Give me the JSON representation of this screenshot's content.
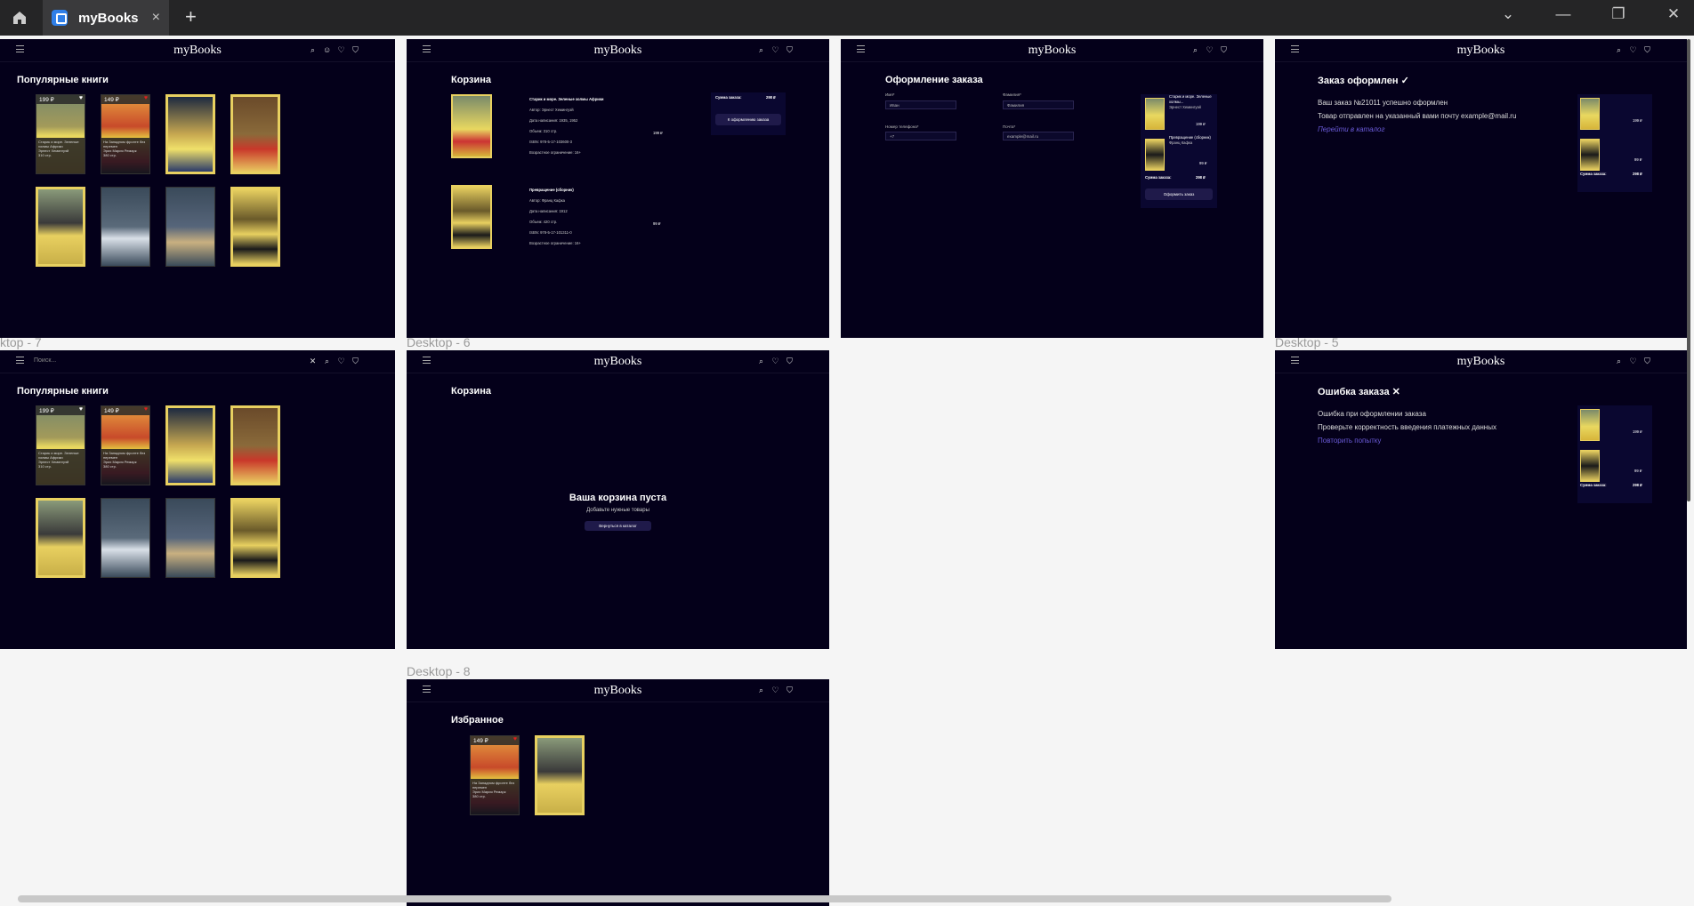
{
  "window": {
    "tab_title": "myBooks",
    "home": "home-icon",
    "new_tab": "+",
    "close_tab": "×",
    "ctrl_minimize": "—",
    "ctrl_restore": "❐",
    "ctrl_close": "✕",
    "ctrl_menu": "⌄"
  },
  "labels": {
    "d7": "ktop - 7",
    "d6": "Desktop - 6",
    "d5": "Desktop - 5",
    "d8": "Desktop - 8"
  },
  "logo": "myBooks",
  "popular": {
    "title": "Популярные книги"
  },
  "books": [
    {
      "price": "199 ₽",
      "author": "ЭРНЕСТ",
      "title": "Старик и море. Зеленые холмы Африки",
      "sub": "Эрнест Хемингуэй",
      "pages": "310 стр."
    },
    {
      "price": "149 ₽",
      "author": "РЕМАРК",
      "title": "На Западном фронте без перемен",
      "sub": "Эрих Мария Ремарк",
      "pages": "380 стр."
    },
    {
      "price": "",
      "author": "ФИЦДЖЕРАЛЬД"
    },
    {
      "price": "",
      "author": "ХАРПЕР ЛИ"
    },
    {
      "price": "",
      "author": "ДОСТОЕВСКИЙ"
    },
    {
      "price": "",
      "author": "КИЗ"
    },
    {
      "price": "",
      "author": "НАД ПРОПАСТЬЮ ВО РЖИ"
    },
    {
      "price": "",
      "author": "КАФКА"
    }
  ],
  "search": {
    "placeholder": "Поиск..."
  },
  "cart": {
    "title": "Корзина",
    "items": [
      {
        "name": "Старик и море. Зеленые холмы Африки",
        "author": "Автор: Эрнест Хемингуэй",
        "date": "Дата написания: 1935, 1952",
        "pages": "Объем: 310 стр.",
        "isbn": "ISBN: 978-5-17-103600-3",
        "age": "Возрастное ограничение: 16+",
        "price": "199 ₽",
        "cover_author": "ЭРНЕСТ ХЕМИНГУЭЙ"
      },
      {
        "name": "Превращение (сборник)",
        "author": "Автор: Франц Кафка",
        "date": "Дата написания: 1912",
        "pages": "Объем: 420 стр.",
        "isbn": "ISBN: 978-5-17-101311-0",
        "age": "Возрастное ограничение: 16+",
        "price": "99 ₽",
        "cover_author": "ФРАНЦ КАФКА"
      }
    ],
    "sum_label": "Сумма заказа:",
    "sum": "298 ₽",
    "checkout": "К оформлению заказа"
  },
  "checkout": {
    "title": "Оформление заказа",
    "name_label": "Имя*",
    "name_val": "Иван",
    "surname_label": "Фамилия*",
    "surname_val": "Фамилия",
    "phone_label": "Номер телефона*",
    "phone_val": "+7",
    "email_label": "Почта*",
    "email_val": "example@mail.ru",
    "item1": "Старик и море. Зеленые холмы...",
    "item1_author": "Эрнест Хемингуэй",
    "item1_price": "199 ₽",
    "item2": "Превращение (сборник)",
    "item2_author": "Франц Кафка",
    "item2_price": "99 ₽",
    "sum_label": "Сумма заказа:",
    "sum": "298 ₽",
    "button": "Оформить заказ"
  },
  "success": {
    "title": "Заказ оформлен",
    "line1": "Ваш заказ №21011 успешно оформлен",
    "line2": "Товар отправлен на указанный вами почту example@mail.ru",
    "link": "Перейти в каталог",
    "sum_label": "Сумма заказа:",
    "sum": "298 ₽",
    "p1": "199 ₽",
    "p2": "99 ₽"
  },
  "empty": {
    "title": "Корзина",
    "heading": "Ваша корзина пуста",
    "sub": "Добавьте нужные товары",
    "button": "Вернуться в каталог"
  },
  "error": {
    "title": "Ошибка заказа",
    "line1": "Ошибка при оформлении заказа",
    "line2": "Проверьте корректность введения платежных данных",
    "link": "Повторить попытку",
    "sum_label": "Сумма заказа:",
    "sum": "298 ₽",
    "p1": "199 ₽",
    "p2": "99 ₽"
  },
  "fav": {
    "title": "Избранное",
    "price": "149 ₽"
  }
}
